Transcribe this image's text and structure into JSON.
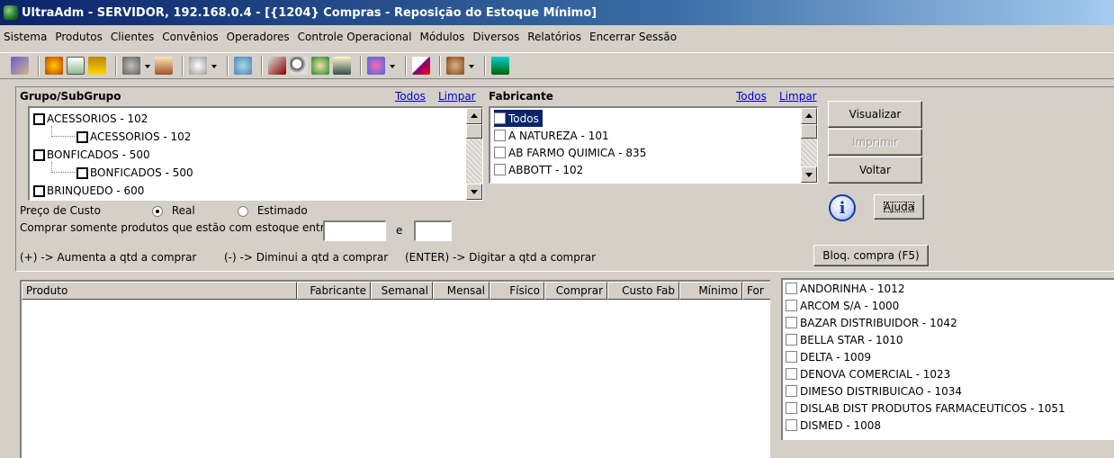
{
  "window": {
    "title": "UltraAdm - SERVIDOR, 192.168.0.4 - [{1204} Compras - Reposição do Estoque Mínimo]"
  },
  "menu": [
    "Sistema",
    "Produtos",
    "Clientes",
    "Convênios",
    "Operadores",
    "Controle Operacional",
    "Módulos",
    "Diversos",
    "Relatórios",
    "Encerrar Sessão"
  ],
  "grupo": {
    "label": "Grupo/SubGrupo",
    "todos": "Todos",
    "limpar": "Limpar",
    "items": [
      {
        "label": "ACESSORIOS - 102",
        "level": 0
      },
      {
        "label": "ACESSORIOS - 102",
        "level": 1
      },
      {
        "label": "BONFICADOS - 500",
        "level": 0
      },
      {
        "label": "BONFICADOS - 500",
        "level": 1
      },
      {
        "label": "BRINQUEDO - 600",
        "level": 0
      }
    ]
  },
  "fabricante": {
    "label": "Fabricante",
    "todos": "Todos",
    "limpar": "Limpar",
    "items": [
      "Todos",
      "A NATUREZA - 101",
      "AB FARMO QUIMICA - 835",
      "ABBOTT - 102"
    ],
    "selected_index": 0
  },
  "buttons": {
    "visualizar": "Visualizar",
    "imprimir": "Imprimir",
    "voltar": "Voltar",
    "ajuda": "Ajuda",
    "bloq": "Bloq. compra (F5)"
  },
  "preco": {
    "label": "Preço de Custo",
    "real": "Real",
    "estimado": "Estimado",
    "selected": "Real"
  },
  "estoque": {
    "label": "Comprar somente produtos que estão com estoque entre:",
    "and": "e"
  },
  "hints": {
    "aumenta": "(+) -> Aumenta a qtd a comprar",
    "diminui": "(-) -> Diminui a qtd a comprar",
    "digitar": "(ENTER) -> Digitar a qtd a comprar"
  },
  "grid": {
    "columns": [
      "Produto",
      "Fabricante",
      "Semanal",
      "Mensal",
      "Físico",
      "Comprar",
      "Custo Fab",
      "Mínimo",
      "For"
    ]
  },
  "suppliers": [
    "ANDORINHA - 1012",
    "ARCOM S/A - 1000",
    "BAZAR DISTRIBUIDOR - 1042",
    "BELLA STAR - 1010",
    "DELTA - 1009",
    "DENOVA COMERCIAL - 1023",
    "DIMESO DISTRIBUICAO - 1034",
    "DISLAB DIST PRODUTOS FARMACEUTICOS - 1051",
    "DISMED - 1008"
  ]
}
